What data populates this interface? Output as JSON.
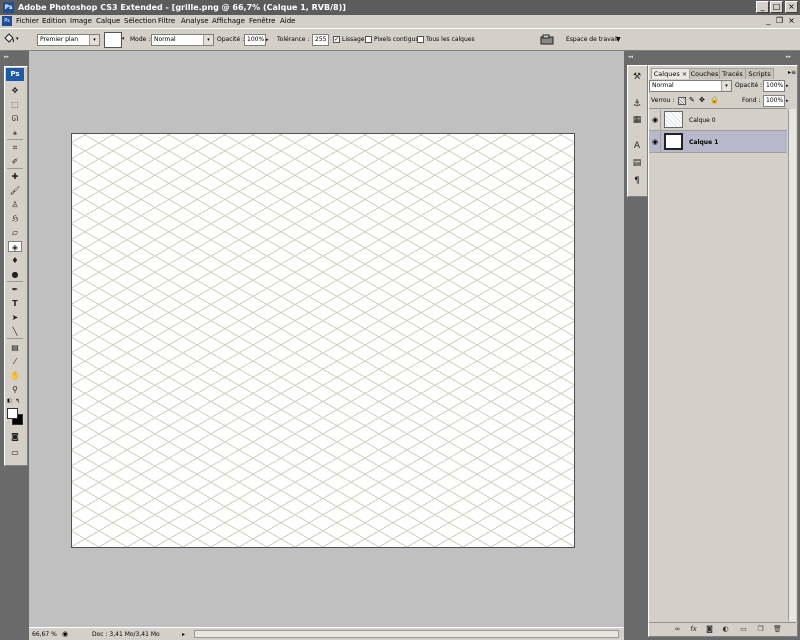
{
  "window": {
    "app_icon": "Ps",
    "title": "Adobe Photoshop CS3 Extended - [grille.png @ 66,7% (Calque 1, RVB/8)]",
    "buttons": [
      "minimize",
      "maximize",
      "close"
    ],
    "minimize_glyph": "_",
    "maximize_glyph": "□",
    "close_glyph": "×"
  },
  "menubar": {
    "doc_icon": "Ps",
    "items": [
      "Fichier",
      "Edition",
      "Image",
      "Calque",
      "Sélection",
      "Filtre",
      "Analyse",
      "Affichage",
      "Fenêtre",
      "Aide"
    ],
    "minimize_glyph": "_",
    "restore_glyph": "❐",
    "close_glyph": "×"
  },
  "options": {
    "tool_icon": "paint-bucket-icon",
    "fill_source": "Premier plan",
    "mode_label": "Mode :",
    "mode_value": "Normal",
    "opacity_label": "Opacité :",
    "opacity_value": "100%",
    "tolerance_label": "Tolérance :",
    "tolerance_value": "255",
    "antialias_label": "Lissage",
    "antialias_checked": true,
    "contiguous_label": "Pixels contigus",
    "contiguous_checked": false,
    "all_layers_label": "Tous les calques",
    "all_layers_checked": false,
    "workspace_label": "Espace de travail"
  },
  "toolbox": {
    "logo": "Ps",
    "tools": [
      "move-tool-icon",
      "marquee-tool-icon",
      "lasso-tool-icon",
      "magic-wand-icon",
      "crop-tool-icon",
      "eyedropper-slice-icon",
      "healing-brush-icon",
      "brush-tool-icon",
      "clone-stamp-icon",
      "history-brush-icon",
      "eraser-icon",
      "paint-bucket-icon",
      "blur-tool-icon",
      "dodge-tool-icon",
      "pen-tool-icon",
      "type-tool-icon",
      "path-selection-icon",
      "line-tool-icon",
      "notes-tool-icon",
      "eyedropper-icon",
      "hand-tool-icon",
      "zoom-tool-icon"
    ]
  },
  "document": {
    "filename": "grille.png",
    "pattern": "isometric-grid",
    "grid_color": "#cfd0c0",
    "background": "#ffffff"
  },
  "status": {
    "zoom": "66,67 %",
    "doc_info": "Doc : 3,41 Mo/3,41 Mo"
  },
  "panel": {
    "tabs": [
      "Calques",
      "Couches",
      "Tracés",
      "Scripts"
    ],
    "active_tab": "Calques",
    "tab_close_glyph": "×",
    "blend_mode": "Normal",
    "opacity_label": "Opacité :",
    "opacity_value": "100%",
    "lock_label": "Verrou :",
    "fill_label": "Fond :",
    "fill_value": "100%",
    "layers": [
      {
        "name": "Calque 0",
        "selected": false,
        "visible": true
      },
      {
        "name": "Calque 1",
        "selected": true,
        "visible": true
      }
    ],
    "bottom_icons": [
      "link-icon",
      "fx-icon",
      "mask-icon",
      "adjustment-icon",
      "group-icon",
      "new-layer-icon",
      "trash-icon"
    ]
  },
  "colors": {
    "chrome": "#d4d0c8",
    "dark_bg": "#6a6a6a",
    "doc_bg": "#c0c0c0",
    "title_bg": "#5c5c5c",
    "selected_layer": "#b7b8c9",
    "accent": "#1a5aa8"
  }
}
